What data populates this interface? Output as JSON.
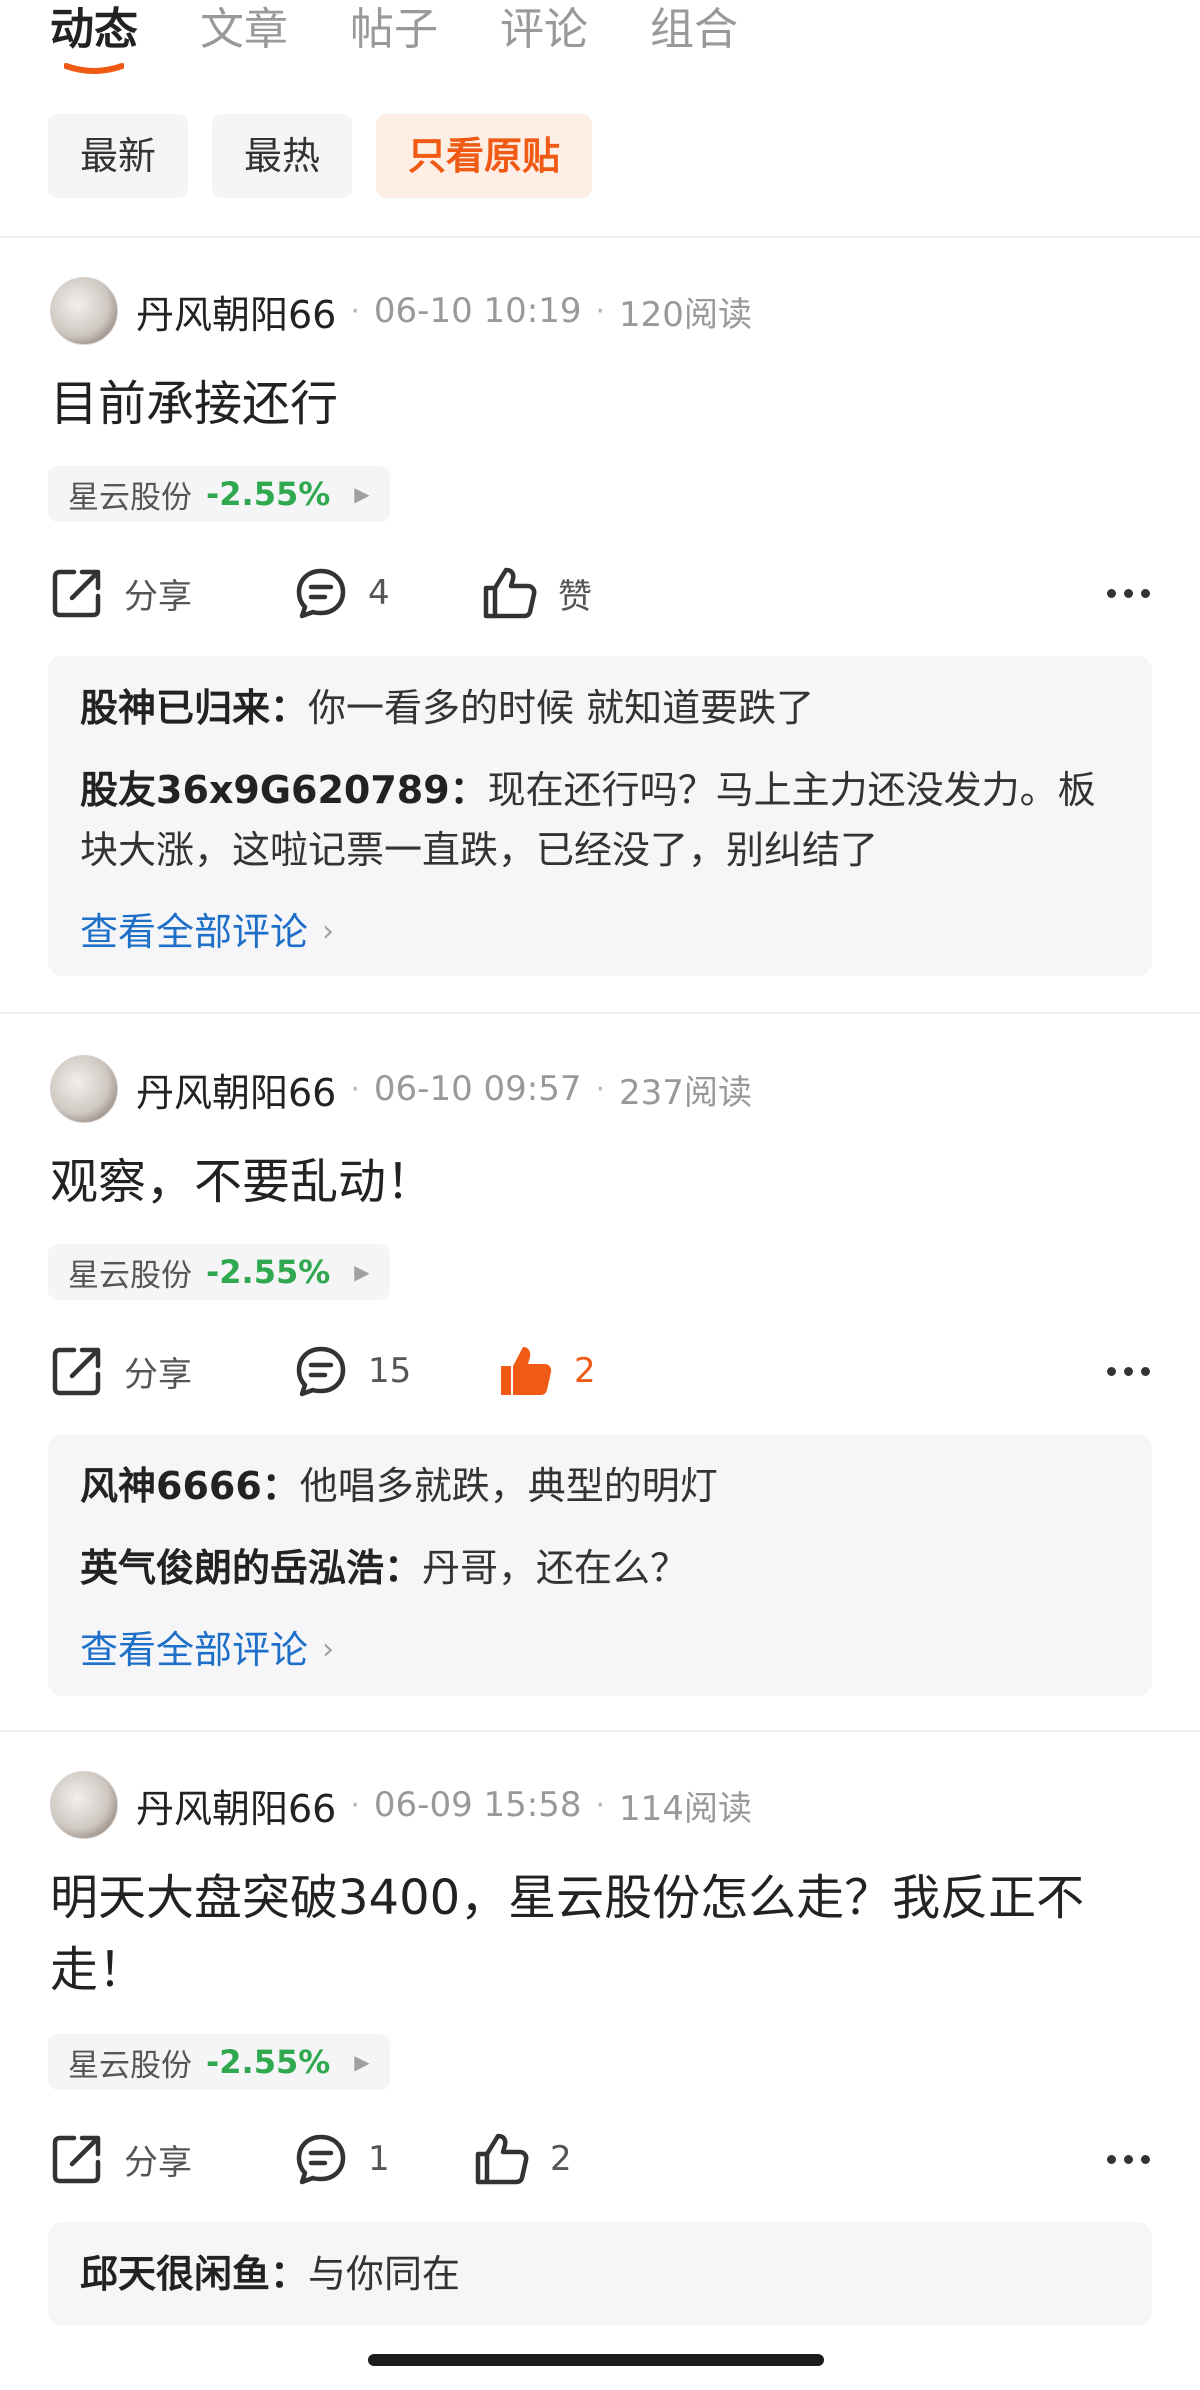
{
  "tabs": [
    {
      "label": "动态",
      "active": true
    },
    {
      "label": "文章",
      "active": false
    },
    {
      "label": "帖子",
      "active": false
    },
    {
      "label": "评论",
      "active": false
    },
    {
      "label": "组合",
      "active": false
    }
  ],
  "filters": [
    {
      "label": "最新",
      "active": false
    },
    {
      "label": "最热",
      "active": false
    },
    {
      "label": "只看原贴",
      "active": true
    }
  ],
  "colors": {
    "accent": "#f05a14",
    "stock_down": "#2fa84f",
    "link": "#1d6fc8"
  },
  "posts": [
    {
      "author": "丹风朝阳66",
      "time": "06-10 10:19",
      "reads": "120阅读",
      "text": "目前承接还行",
      "stock": {
        "name": "星云股份",
        "change": "-2.55%"
      },
      "share_label": "分享",
      "comment_count": "4",
      "like_label": "赞",
      "liked": false,
      "comments": [
        {
          "user": "股神已归来：",
          "text": "你一看多的时候 就知道要跌了"
        },
        {
          "user": "股友36x9G620789：",
          "text": "现在还行吗？马上主力还没发力。板块大涨，这啦记票一直跌，已经没了，别纠结了"
        }
      ],
      "view_all": "查看全部评论"
    },
    {
      "author": "丹风朝阳66",
      "time": "06-10 09:57",
      "reads": "237阅读",
      "text": "观察，不要乱动！",
      "stock": {
        "name": "星云股份",
        "change": "-2.55%"
      },
      "share_label": "分享",
      "comment_count": "15",
      "like_label": "2",
      "liked": true,
      "comments": [
        {
          "user": "风神6666：",
          "text": "他唱多就跌，典型的明灯"
        },
        {
          "user": "英气俊朗的岳泓浩：",
          "text": "丹哥，还在么？"
        }
      ],
      "view_all": "查看全部评论"
    },
    {
      "author": "丹风朝阳66",
      "time": "06-09 15:58",
      "reads": "114阅读",
      "text": "明天大盘突破3400，星云股份怎么走？我反正不走！",
      "stock": {
        "name": "星云股份",
        "change": "-2.55%"
      },
      "share_label": "分享",
      "comment_count": "1",
      "like_label": "2",
      "liked": false,
      "comments": [
        {
          "user": "邱天很闲鱼：",
          "text": "与你同在"
        }
      ]
    }
  ]
}
